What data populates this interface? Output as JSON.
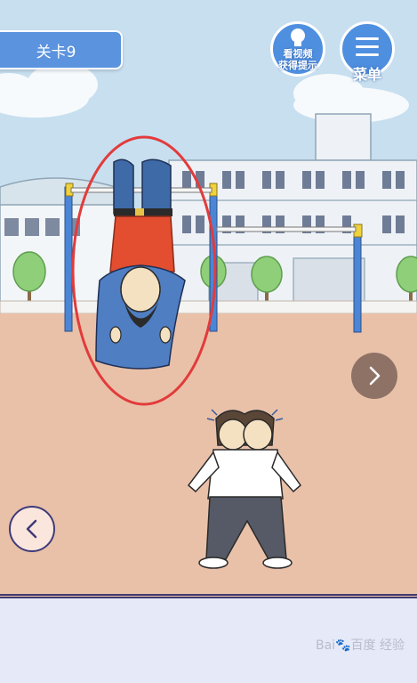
{
  "level": {
    "label": "关卡9"
  },
  "hint_button": {
    "label": "看视频\n获得提示",
    "icon": "lightbulb-icon"
  },
  "menu_button": {
    "label": "菜单",
    "icon": "hamburger-icon"
  },
  "nav": {
    "next_icon": "chevron-right-icon",
    "back_icon": "chevron-left-icon"
  },
  "watermark": {
    "text": "Bai🐾百度 经验"
  },
  "colors": {
    "sky": "#c8dff0",
    "ground": "#e9c1a9",
    "accent_blue": "#4f8fe0",
    "highlight_circle": "#e23b3b",
    "panel": "#e6e9f7"
  }
}
